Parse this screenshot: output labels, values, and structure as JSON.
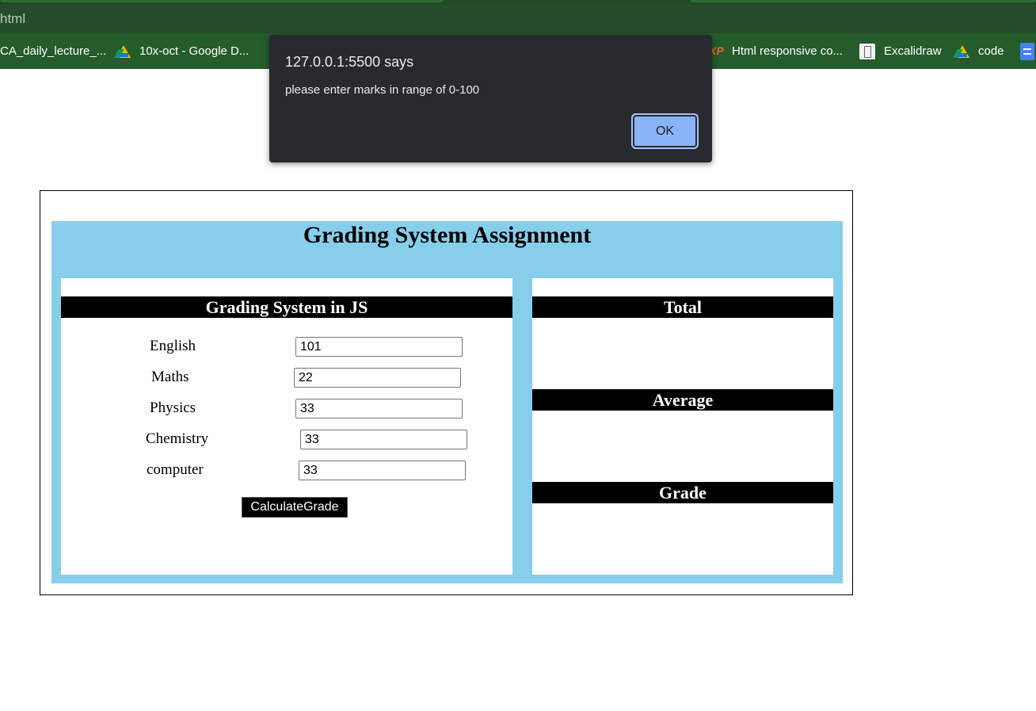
{
  "browser": {
    "url_fragment": "html",
    "bookmarks": [
      {
        "label": "CA_daily_lecture_...",
        "icon": "none"
      },
      {
        "label": "10x-oct - Google D...",
        "icon": "google-drive-icon"
      },
      {
        "label": "Html responsive co...",
        "icon": "xp-icon"
      },
      {
        "label": "Excalidraw",
        "icon": "excalidraw-icon"
      },
      {
        "label": "code",
        "icon": "google-drive-icon"
      }
    ],
    "xp_glyph": "XP"
  },
  "page": {
    "title": "Grading System Assignment",
    "form": {
      "heading": "Grading System in JS",
      "subjects": [
        {
          "label": "English",
          "value": "101"
        },
        {
          "label": "Maths",
          "value": "22"
        },
        {
          "label": "Physics",
          "value": "33"
        },
        {
          "label": "Chemistry",
          "value": "33"
        },
        {
          "label": "computer",
          "value": "33"
        }
      ],
      "button_label": "CalculateGrade"
    },
    "results": {
      "total_heading": "Total",
      "average_heading": "Average",
      "grade_heading": "Grade"
    }
  },
  "dialog": {
    "title": "127.0.0.1:5500 says",
    "message": "please enter marks in range of 0-100",
    "ok_label": "OK"
  },
  "colors": {
    "panel_blue": "#87ceeb",
    "browser_green": "#255c2b",
    "dialog_bg": "#292a2d",
    "ok_button": "#8ab4f8"
  }
}
